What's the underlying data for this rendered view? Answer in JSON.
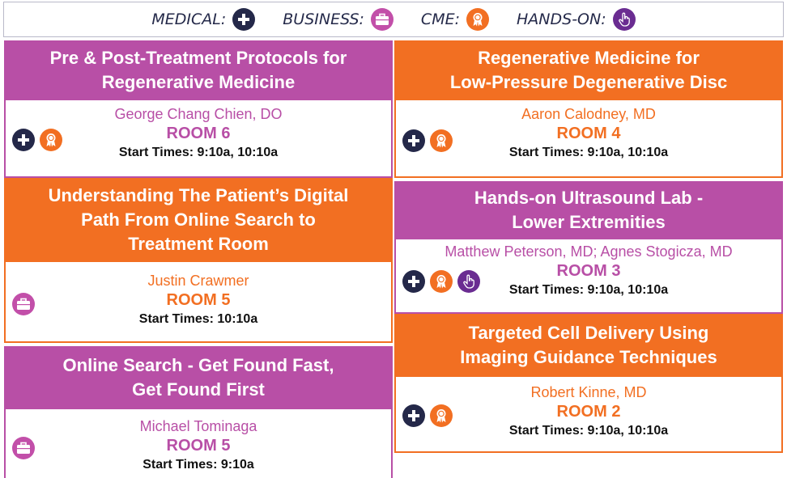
{
  "legend": [
    {
      "label": "MEDICAL:",
      "icon": "plus-icon",
      "color": "#242849"
    },
    {
      "label": "BUSINESS:",
      "icon": "briefcase-icon",
      "color": "#c24fa9"
    },
    {
      "label": "CME:",
      "icon": "award-ribbon-icon",
      "color": "#f26f22"
    },
    {
      "label": "HANDS-ON:",
      "icon": "hand-pointer-icon",
      "color": "#6a2c91"
    }
  ],
  "colors": {
    "purple": "#b84fa6",
    "orange": "#f26f22",
    "navy": "#242849",
    "hands_purple": "#6a2c91"
  },
  "sessions": [
    {
      "title_line1": "Pre & Post-Treatment Protocols for",
      "title_line2": "Regenerative Medicine",
      "speaker": "George Chang Chien, DO",
      "room": "ROOM 6",
      "times": "Start Times: 9:10a, 10:10a",
      "tags": [
        "medical",
        "cme"
      ]
    },
    {
      "title_line1": "Understanding The Patient’s Digital",
      "title_line2": "Path From Online Search to",
      "title_line3": "Treatment Room",
      "speaker": "Justin Crawmer",
      "room": "ROOM 5",
      "times": "Start Times: 10:10a",
      "tags": [
        "business"
      ]
    },
    {
      "title_line1": "Online Search - Get Found Fast,",
      "title_line2": "Get Found First",
      "speaker": "Michael Tominaga",
      "room": "ROOM 5",
      "times": "Start Times: 9:10a",
      "tags": [
        "business"
      ]
    },
    {
      "title_line1": "Regenerative Medicine for",
      "title_line2": "Low-Pressure Degenerative Disc",
      "speaker": "Aaron Calodney, MD",
      "room": "ROOM 4",
      "times": "Start Times: 9:10a, 10:10a",
      "tags": [
        "medical",
        "cme"
      ]
    },
    {
      "title_line1": "Hands-on Ultrasound Lab -",
      "title_line2": "Lower Extremities",
      "speaker": "Matthew Peterson, MD; Agnes Stogicza, MD",
      "room": "ROOM 3",
      "times": "Start Times: 9:10a, 10:10a",
      "tags": [
        "medical",
        "cme",
        "hands-on"
      ]
    },
    {
      "title_line1": "Targeted Cell Delivery Using",
      "title_line2": "Imaging Guidance Techniques",
      "speaker": "Robert Kinne, MD",
      "room": "ROOM 2",
      "times": "Start Times: 9:10a, 10:10a",
      "tags": [
        "medical",
        "cme"
      ]
    }
  ]
}
